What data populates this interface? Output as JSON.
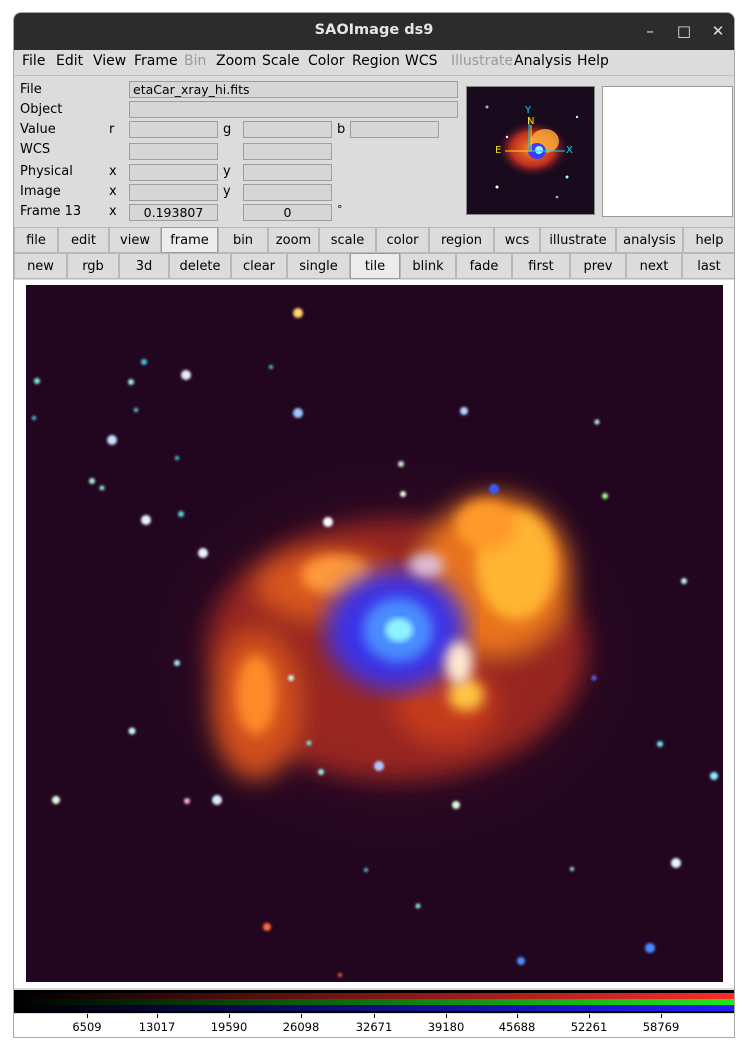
{
  "window": {
    "title": "SAOImage ds9"
  },
  "window_controls": {
    "minimize": "–",
    "maximize": "□",
    "close": "✕"
  },
  "menu": [
    "File",
    "Edit",
    "View",
    "Frame",
    "Bin",
    "Zoom",
    "Scale",
    "Color",
    "Region",
    "WCS",
    "Illustrate",
    "Analysis",
    "Help"
  ],
  "menu_disabled": [
    "Bin",
    "Illustrate"
  ],
  "info": {
    "file_label": "File",
    "file_value": "etaCar_xray_hi.fits",
    "object_label": "Object",
    "object_value": "",
    "value_label": "Value",
    "value_r": "r",
    "value_g": "g",
    "value_b": "b",
    "wcs_label": "WCS",
    "physical_label": "Physical",
    "physical_x": "x",
    "physical_y": "y",
    "image_label": "Image",
    "image_x": "x",
    "image_y": "y",
    "frame_label": "Frame 13",
    "frame_x": "x",
    "frame_x_value": "0.193807",
    "frame_y_value": "0",
    "frame_unit": "°"
  },
  "panner": {
    "y_label": "Y",
    "n_label": "N",
    "e_label": "E",
    "x_label": "X"
  },
  "button_row1": [
    "file",
    "edit",
    "view",
    "frame",
    "bin",
    "zoom",
    "scale",
    "color",
    "region",
    "wcs",
    "illustrate",
    "analysis",
    "help"
  ],
  "button_row1_active": "frame",
  "button_row2": [
    "new",
    "rgb",
    "3d",
    "delete",
    "clear",
    "single",
    "tile",
    "blink",
    "fade",
    "first",
    "prev",
    "next",
    "last"
  ],
  "button_row2_active": "tile",
  "colorbar": {
    "ticks": [
      "6509",
      "13017",
      "19590",
      "26098",
      "32671",
      "39180",
      "45688",
      "52261",
      "58769"
    ],
    "colors": {
      "red": "#ff2a2a",
      "green": "#1ee81e",
      "blue": "#1e1eff"
    }
  }
}
